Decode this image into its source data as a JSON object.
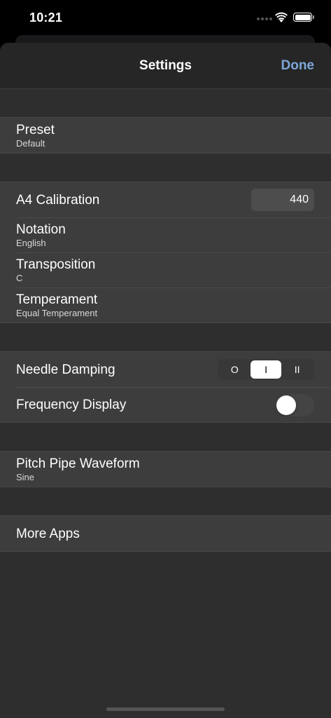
{
  "status_bar": {
    "time": "10:21"
  },
  "navbar": {
    "title": "Settings",
    "done_label": "Done"
  },
  "sections": {
    "preset": {
      "title": "Preset",
      "value": "Default"
    },
    "calibration": {
      "title": "A4 Calibration",
      "value": "440"
    },
    "notation": {
      "title": "Notation",
      "value": "English"
    },
    "transposition": {
      "title": "Transposition",
      "value": "C"
    },
    "temperament": {
      "title": "Temperament",
      "value": "Equal Temperament"
    },
    "needle_damping": {
      "title": "Needle Damping",
      "options": [
        "O",
        "I",
        "II"
      ],
      "selected": "I"
    },
    "frequency_display": {
      "title": "Frequency Display",
      "enabled": false
    },
    "pitch_pipe": {
      "title": "Pitch Pipe Waveform",
      "value": "Sine"
    },
    "more_apps": {
      "title": "More Apps"
    }
  },
  "colors": {
    "accent": "#7ea7d8",
    "background": "#2e2e2e",
    "cell": "#3d3d3d"
  }
}
